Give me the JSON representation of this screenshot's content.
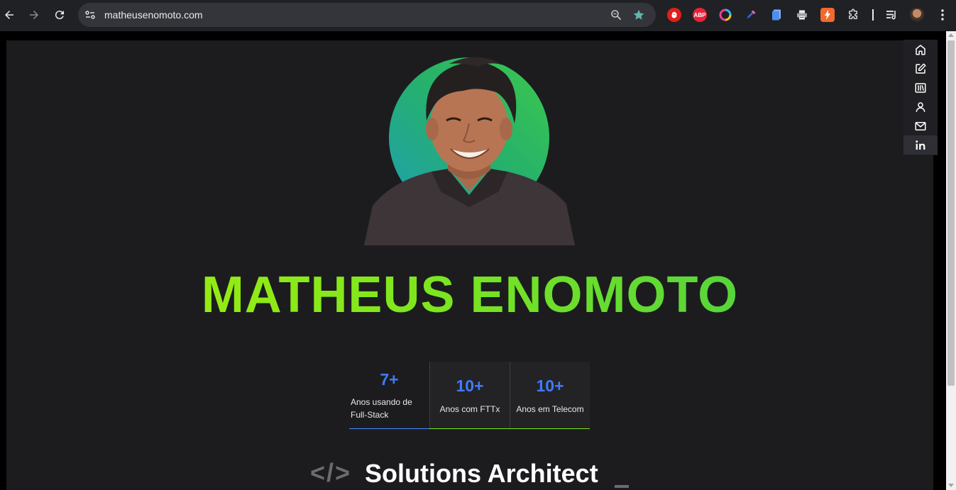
{
  "browser": {
    "url": "matheusenomoto.com",
    "extensions": [
      {
        "name": "stop-extension-icon",
        "label": "",
        "color": "#e0201b"
      },
      {
        "name": "adblock-plus-icon",
        "label": "ABP",
        "color": "#e8213a"
      },
      {
        "name": "color-ring-extension-icon",
        "label": "",
        "color": "#2db7f5"
      },
      {
        "name": "color-picker-icon",
        "label": "",
        "color": "#3b5bdb"
      },
      {
        "name": "docs-extension-icon",
        "label": "",
        "color": "#4d8ef0"
      },
      {
        "name": "printer-extension-icon",
        "label": "",
        "color": "#9aa0a6"
      },
      {
        "name": "lightning-extension-icon",
        "label": "",
        "color": "#f26a2e"
      }
    ]
  },
  "hero": {
    "name": "MATHEUS ENOMOTO",
    "name_gradient": [
      "#a8f00a",
      "#3ecb4b"
    ]
  },
  "stats": [
    {
      "value": "7+",
      "label": "Anos usando de Full-Stack"
    },
    {
      "value": "10+",
      "label": "Anos com FTTx"
    },
    {
      "value": "10+",
      "label": "Anos em Telecom"
    }
  ],
  "role": {
    "tag": "</>",
    "title": "Solutions Architect"
  },
  "sidenav": [
    {
      "name": "home-icon"
    },
    {
      "name": "edit-icon"
    },
    {
      "name": "library-icon"
    },
    {
      "name": "user-icon"
    },
    {
      "name": "mail-icon"
    },
    {
      "name": "linkedin-icon"
    }
  ],
  "colors": {
    "accent_blue": "#3e7bff",
    "accent_green": "#7ee61f",
    "background": "#1c1c1f"
  }
}
